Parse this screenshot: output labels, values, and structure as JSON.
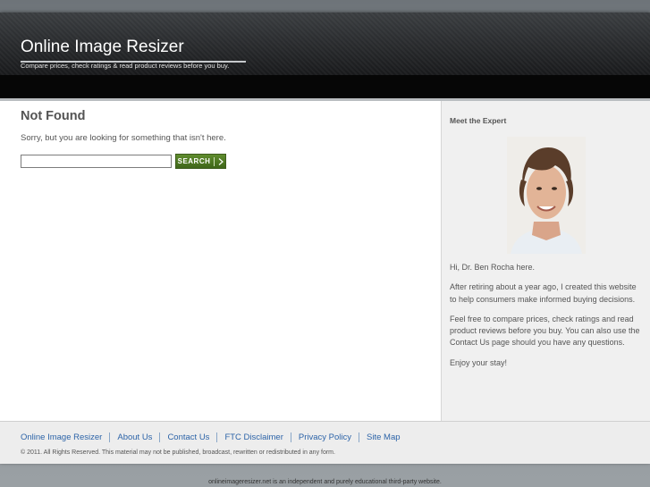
{
  "header": {
    "site_title": "Online Image Resizer",
    "tagline": "Compare prices, check ratings & read product reviews before you buy."
  },
  "main": {
    "heading": "Not Found",
    "message": "Sorry, but you are looking for something that isn't here.",
    "search": {
      "value": "",
      "placeholder": "",
      "button_label": "SEARCH"
    }
  },
  "sidebar": {
    "heading": "Meet the Expert",
    "paragraphs": [
      "Hi, Dr. Ben Rocha here.",
      "After retiring about a year ago, I created this website to help consumers make informed buying decisions.",
      "Feel free to compare prices, check ratings and read product reviews before you buy. You can also use the Contact Us page should you have any questions.",
      "Enjoy your stay!"
    ]
  },
  "footer": {
    "links": [
      "Online Image Resizer",
      "About Us",
      "Contact Us",
      "FTC Disclaimer",
      "Privacy Policy",
      "Site Map"
    ],
    "copyright": "© 2011. All Rights Reserved. This material may not be published, broadcast, rewritten or redistributed in any form."
  },
  "bottom_note": "onlineimageresizer.net is an independent and purely educational third-party website.",
  "colors": {
    "accent_green": "#4a7322",
    "link_blue": "#2d64a8",
    "header_dark": "#1a1b1d"
  }
}
